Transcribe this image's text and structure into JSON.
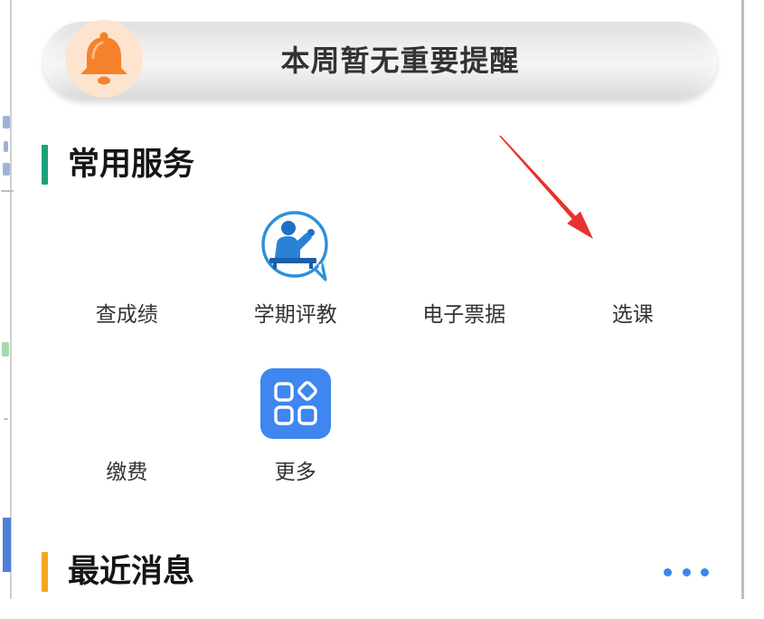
{
  "notice": {
    "text": "本周暂无重要提醒",
    "icon": "bell-icon"
  },
  "services": {
    "title": "常用服务",
    "items": [
      {
        "label": "查成绩"
      },
      {
        "label": "学期评教",
        "icon": "teacher-icon"
      },
      {
        "label": "电子票据"
      },
      {
        "label": "选课"
      },
      {
        "label": "缴费"
      },
      {
        "label": "更多",
        "icon": "app-grid-icon"
      }
    ]
  },
  "messages": {
    "title": "最近消息",
    "more_icon": "more-dots-icon"
  },
  "colors": {
    "services_accent": "#1aa17a",
    "messages_accent": "#f5a623",
    "bell": "#f5822a",
    "bell_bg": "#fde4cf",
    "primary_blue": "#3a87ee",
    "annotation_red": "#e8322f"
  }
}
